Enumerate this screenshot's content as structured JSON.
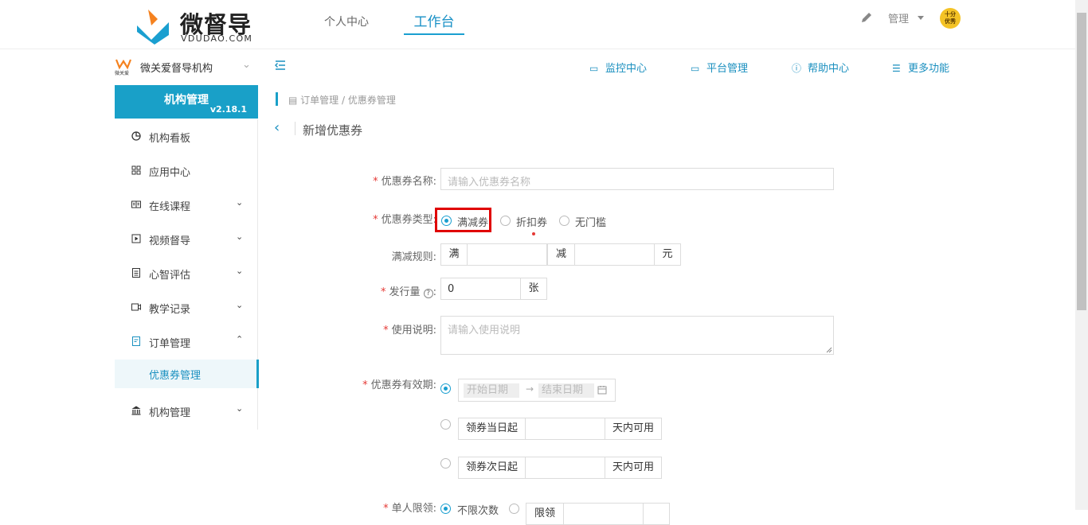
{
  "header": {
    "logo_name": "微督导",
    "logo_sub": "VDUDAO.COM",
    "nav": [
      "个人中心",
      "工作台"
    ],
    "active_nav": "工作台",
    "admin_label": "管理",
    "avatar_text_top": "十分",
    "avatar_text_bottom": "优秀"
  },
  "org": {
    "logo_text": "微关爱",
    "name": "微关爱督导机构"
  },
  "sidebar": {
    "title": "机构管理",
    "version": "v2.18.1",
    "items": [
      {
        "label": "机构看板",
        "icon": "pie-chart-icon",
        "chevron": ""
      },
      {
        "label": "应用中心",
        "icon": "grid-icon",
        "chevron": ""
      },
      {
        "label": "在线课程",
        "icon": "book-icon",
        "chevron": "⌄"
      },
      {
        "label": "视频督导",
        "icon": "play-icon",
        "chevron": "⌄"
      },
      {
        "label": "心智评估",
        "icon": "document-icon",
        "chevron": "⌄"
      },
      {
        "label": "教学记录",
        "icon": "video-icon",
        "chevron": "⌄"
      },
      {
        "label": "订单管理",
        "icon": "order-icon",
        "chevron": "⌃"
      },
      {
        "label": "优惠券管理",
        "icon": "",
        "chevron": ""
      },
      {
        "label": "机构管理",
        "icon": "bank-icon",
        "chevron": "⌄"
      }
    ]
  },
  "toolbar": {
    "monitor": "监控中心",
    "platform": "平台管理",
    "help": "帮助中心",
    "more": "更多功能"
  },
  "breadcrumb": "订单管理 / 优惠券管理",
  "page_title": "新增优惠券",
  "form": {
    "name_label": "优惠券名称:",
    "name_placeholder": "请输入优惠券名称",
    "type_label": "优惠券类型:",
    "type_options": [
      "满减券",
      "折扣券",
      "无门槛"
    ],
    "type_selected": "满减券",
    "rule_label": "满减规则:",
    "rule_full": "满",
    "rule_minus": "减",
    "rule_unit": "元",
    "issue_label": "发行量",
    "issue_value": "0",
    "issue_unit": "张",
    "desc_label": "使用说明:",
    "desc_placeholder": "请输入使用说明",
    "validity_label": "优惠券有效期:",
    "start_placeholder": "开始日期",
    "end_placeholder": "结束日期",
    "from_today": "领券当日起",
    "from_next_day": "领券次日起",
    "days_available": "天内可用",
    "limit_label": "单人限领:",
    "limit_option": "不限次数",
    "limit_option2": "限领"
  },
  "colors": {
    "accent": "#19a0c8",
    "highlight": "#e00000",
    "required": "#e53935"
  }
}
